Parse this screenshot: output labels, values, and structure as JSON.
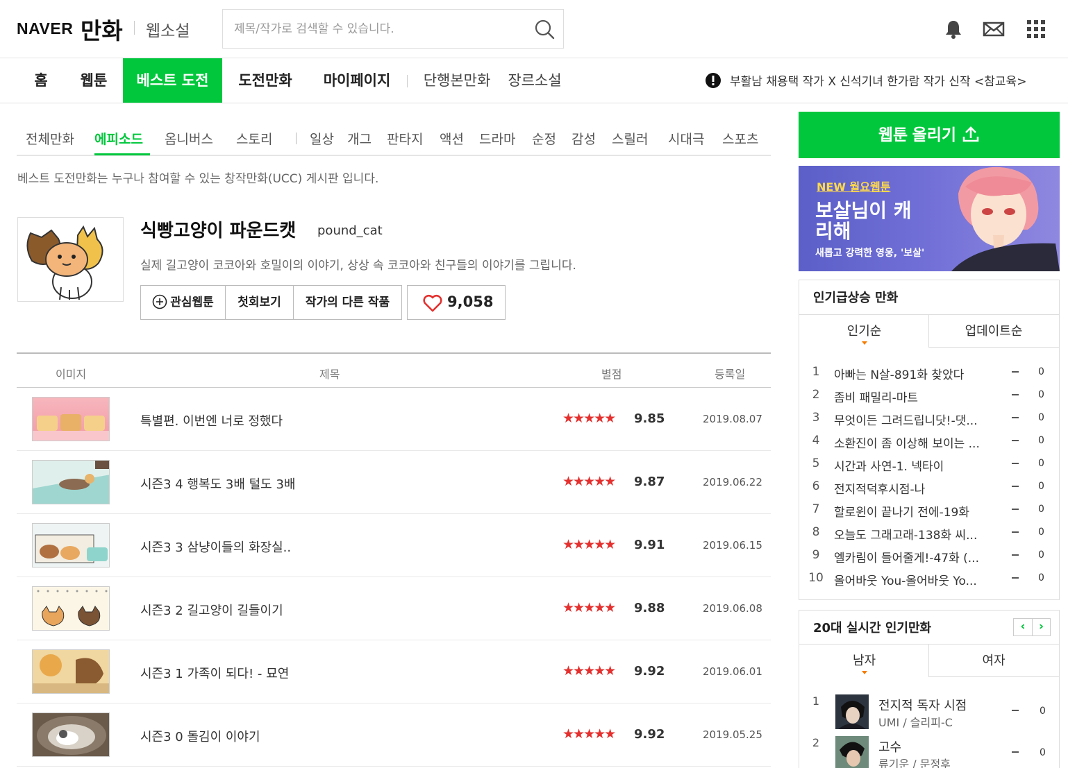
{
  "header": {
    "logo_naver": "NAVER",
    "logo_manhwa": "만화",
    "logo_novel": "웹소설",
    "search_placeholder": "제목/작가로 검색할 수 있습니다.",
    "icons": [
      "search-icon",
      "bell-icon",
      "mail-icon",
      "apps-grid-icon"
    ]
  },
  "nav": {
    "items": [
      "홈",
      "웹툰",
      "베스트 도전",
      "도전만화",
      "마이페이지",
      "단행본만화",
      "장르소설"
    ],
    "active": "베스트 도전",
    "notice": "부활남 채용택 작가 X 신석기녀 한가람 작가 신작 <참교육>"
  },
  "genre_tabs": {
    "items": [
      "전체만화",
      "에피소드",
      "옴니버스",
      "스토리",
      "일상",
      "개그",
      "판타지",
      "액션",
      "드라마",
      "순정",
      "감성",
      "스릴러",
      "시대극",
      "스포츠"
    ],
    "active": "에피소드"
  },
  "description": "베스트 도전만화는 누구나 참여할 수 있는 창작만화(UCC) 게시판 입니다.",
  "webtoon": {
    "title": "식빵고양이 파운드캣",
    "author": "pound_cat",
    "summary": "실제 길고양이 코코아와 호밀이의 이야기, 상상 속 코코아와 친구들의 이야기를 그립니다.",
    "buttons": [
      "관심웹툰",
      "첫회보기",
      "작가의 다른 작품"
    ],
    "likes": "9,058"
  },
  "list": {
    "headers": [
      "이미지",
      "제목",
      "별점",
      "등록일"
    ],
    "rows": [
      {
        "title": "특별편. 이번엔 너로 정했다",
        "stars": "★★★★★",
        "score": "9.85",
        "date": "2019.08.07"
      },
      {
        "title": "시즌3 4 행복도 3배 털도 3배",
        "stars": "★★★★★",
        "score": "9.87",
        "date": "2019.06.22"
      },
      {
        "title": "시즌3 3 삼냥이들의 화장실..",
        "stars": "★★★★★",
        "score": "9.91",
        "date": "2019.06.15"
      },
      {
        "title": "시즌3 2 길고양이 길들이기",
        "stars": "★★★★★",
        "score": "9.88",
        "date": "2019.06.08"
      },
      {
        "title": "시즌3 1 가족이 되다! - 묘연",
        "stars": "★★★★★",
        "score": "9.92",
        "date": "2019.06.01"
      },
      {
        "title": "시즌3 0 돌김이 이야기",
        "stars": "★★★★★",
        "score": "9.92",
        "date": "2019.05.25"
      }
    ]
  },
  "sidebar": {
    "upload_label": "웹툰 올리기",
    "banner": {
      "tag": "NEW 월요웹툰",
      "title": "보살님이 캐리해",
      "subtitle": "새롭고 강력한 영웅, '보살'"
    },
    "rising": {
      "title": "인기급상승 만화",
      "tabs": [
        "인기순",
        "업데이트순"
      ],
      "items": [
        {
          "rank": "1",
          "title": "아빠는 N살-891화 찾았다",
          "change": "0"
        },
        {
          "rank": "2",
          "title": "좀비 패밀리-마트",
          "change": "0"
        },
        {
          "rank": "3",
          "title": "무엇이든 그려드립니닷!-댓...",
          "change": "0"
        },
        {
          "rank": "4",
          "title": "소환진이 좀 이상해 보이는 ...",
          "change": "0"
        },
        {
          "rank": "5",
          "title": "시간과 사연-1. 넥타이",
          "change": "0"
        },
        {
          "rank": "6",
          "title": "전지적덕후시점-나",
          "change": "0"
        },
        {
          "rank": "7",
          "title": "할로윈이 끝나기 전에-19화",
          "change": "0"
        },
        {
          "rank": "8",
          "title": "오늘도 그래고래-138화 씨...",
          "change": "0"
        },
        {
          "rank": "9",
          "title": "엘카림이 들어줄게!-47화 (...",
          "change": "0"
        },
        {
          "rank": "10",
          "title": "올어바웃 You-올어바웃 Yo...",
          "change": "0"
        }
      ]
    },
    "realtime": {
      "title": "20대 실시간 인기만화",
      "tabs": [
        "남자",
        "여자"
      ],
      "prev": "‹",
      "next": "›",
      "items": [
        {
          "rank": "1",
          "title": "전지적 독자 시점",
          "author": "UMI / 슬리피-C",
          "change": "0"
        },
        {
          "rank": "2",
          "title": "고수",
          "author": "류기운 / 문정후",
          "change": "0"
        }
      ]
    }
  }
}
